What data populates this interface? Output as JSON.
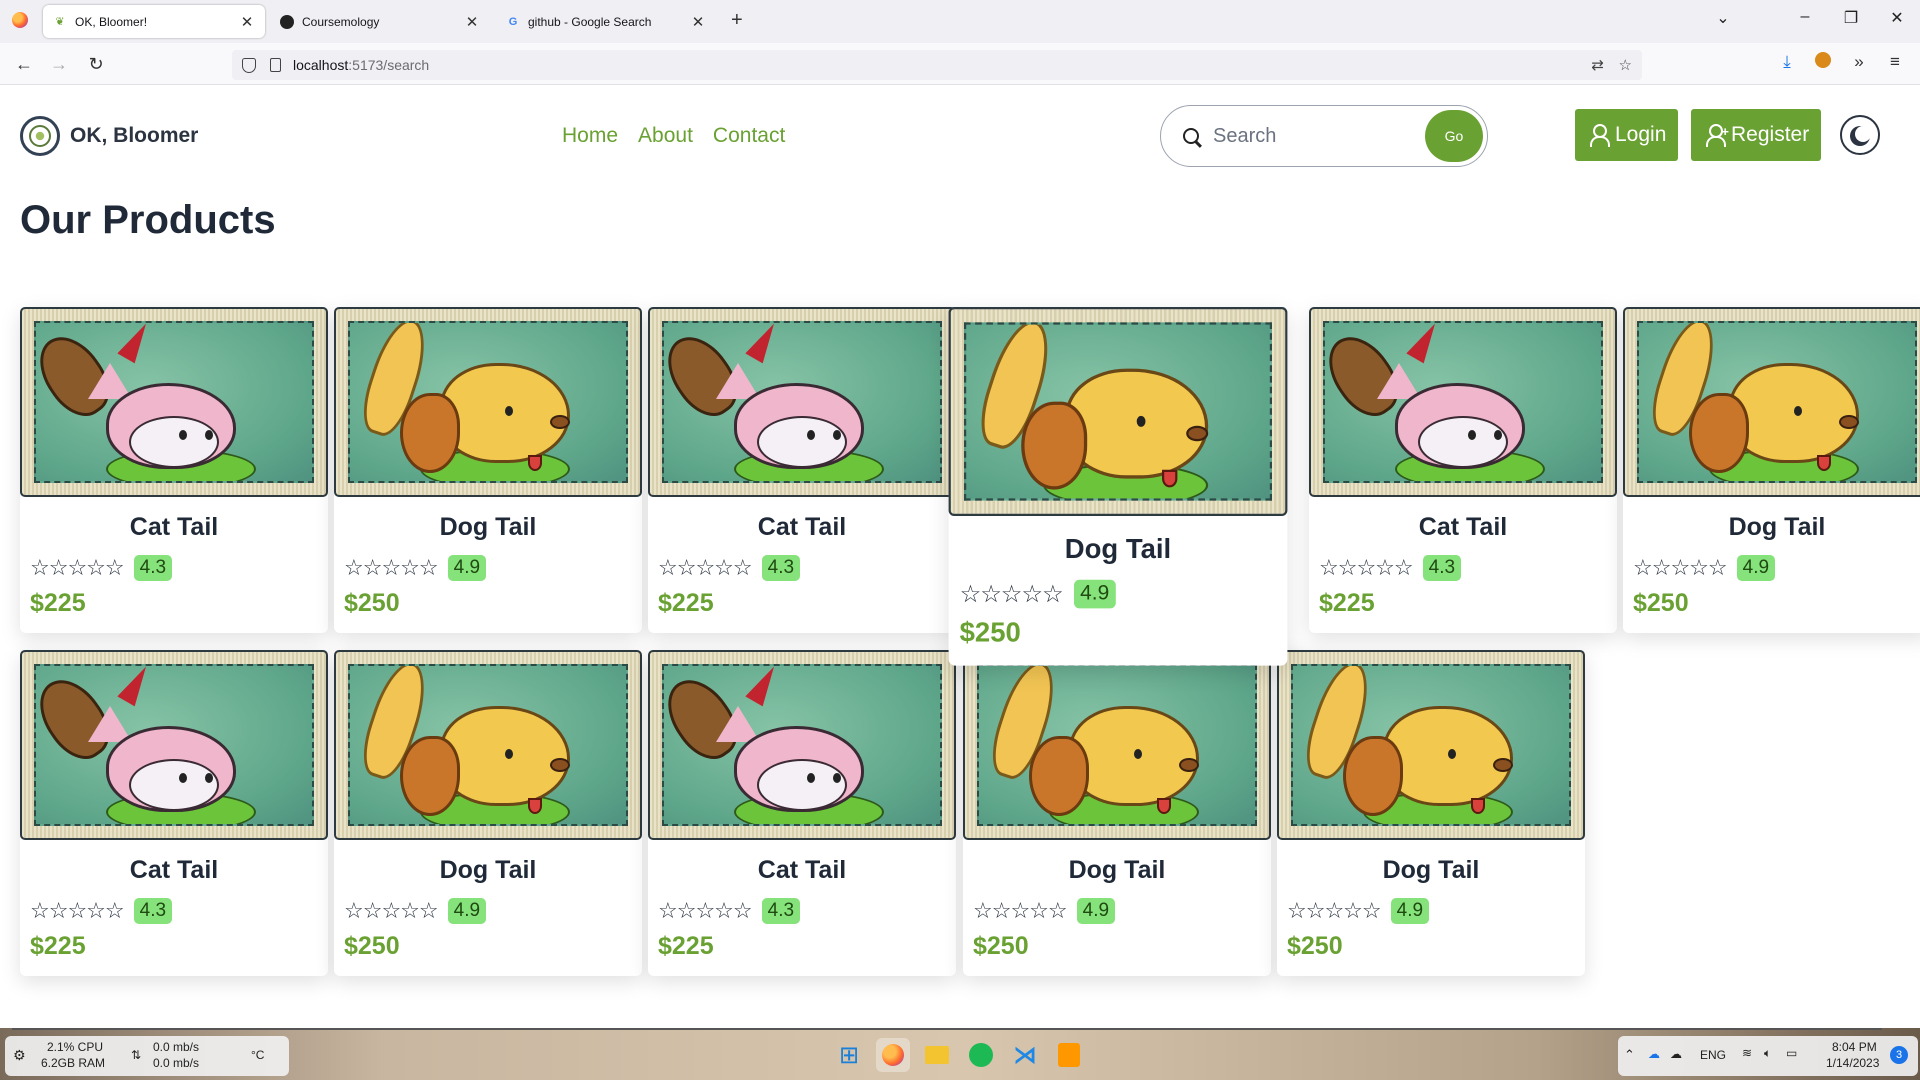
{
  "browser": {
    "tabs": [
      {
        "title": "OK, Bloomer!",
        "favicon": "leaf-icon",
        "active": true
      },
      {
        "title": "Coursemology",
        "favicon": "coursemology-icon",
        "active": false
      },
      {
        "title": "github - Google Search",
        "favicon": "google-icon",
        "active": false
      }
    ],
    "url_host": "localhost",
    "url_path": ":5173/search"
  },
  "header": {
    "brand": "OK, Bloomer",
    "nav": [
      "Home",
      "About",
      "Contact"
    ],
    "search_placeholder": "Search",
    "go_label": "Go",
    "login_label": "Login",
    "register_label": "Register"
  },
  "page_title": "Our Products",
  "products": [
    {
      "name": "Cat Tail",
      "rating": "4.3",
      "price": "$225",
      "kind": "cat"
    },
    {
      "name": "Dog Tail",
      "rating": "4.9",
      "price": "$250",
      "kind": "dog"
    },
    {
      "name": "Cat Tail",
      "rating": "4.3",
      "price": "$225",
      "kind": "cat"
    },
    {
      "name": "Dog Tail",
      "rating": "4.9",
      "price": "$250",
      "kind": "dog"
    },
    {
      "name": "Cat Tail",
      "rating": "4.3",
      "price": "$225",
      "kind": "cat"
    },
    {
      "name": "Dog Tail",
      "rating": "4.9",
      "price": "$250",
      "kind": "dog"
    },
    {
      "name": "Cat Tail",
      "rating": "4.3",
      "price": "$225",
      "kind": "cat"
    },
    {
      "name": "Dog Tail",
      "rating": "4.9",
      "price": "$250",
      "kind": "dog"
    },
    {
      "name": "Cat Tail",
      "rating": "4.3",
      "price": "$225",
      "kind": "cat"
    },
    {
      "name": "Dog Tail",
      "rating": "4.9",
      "price": "$250",
      "kind": "dog"
    },
    {
      "name": "Dog Tail",
      "rating": "4.9",
      "price": "$250",
      "kind": "dog"
    }
  ],
  "stars_glyph": "☆☆☆☆☆",
  "taskbar": {
    "cpu": "2.1% CPU",
    "ram": "6.2GB RAM",
    "net_up": "0.0 mb/s",
    "net_down": "0.0 mb/s",
    "temp": "°C",
    "lang": "ENG",
    "time": "8:04 PM",
    "date": "1/14/2023",
    "notifications": "3"
  },
  "colors": {
    "accent": "#6aa133",
    "badge": "#86e27a",
    "text": "#1f2937"
  }
}
